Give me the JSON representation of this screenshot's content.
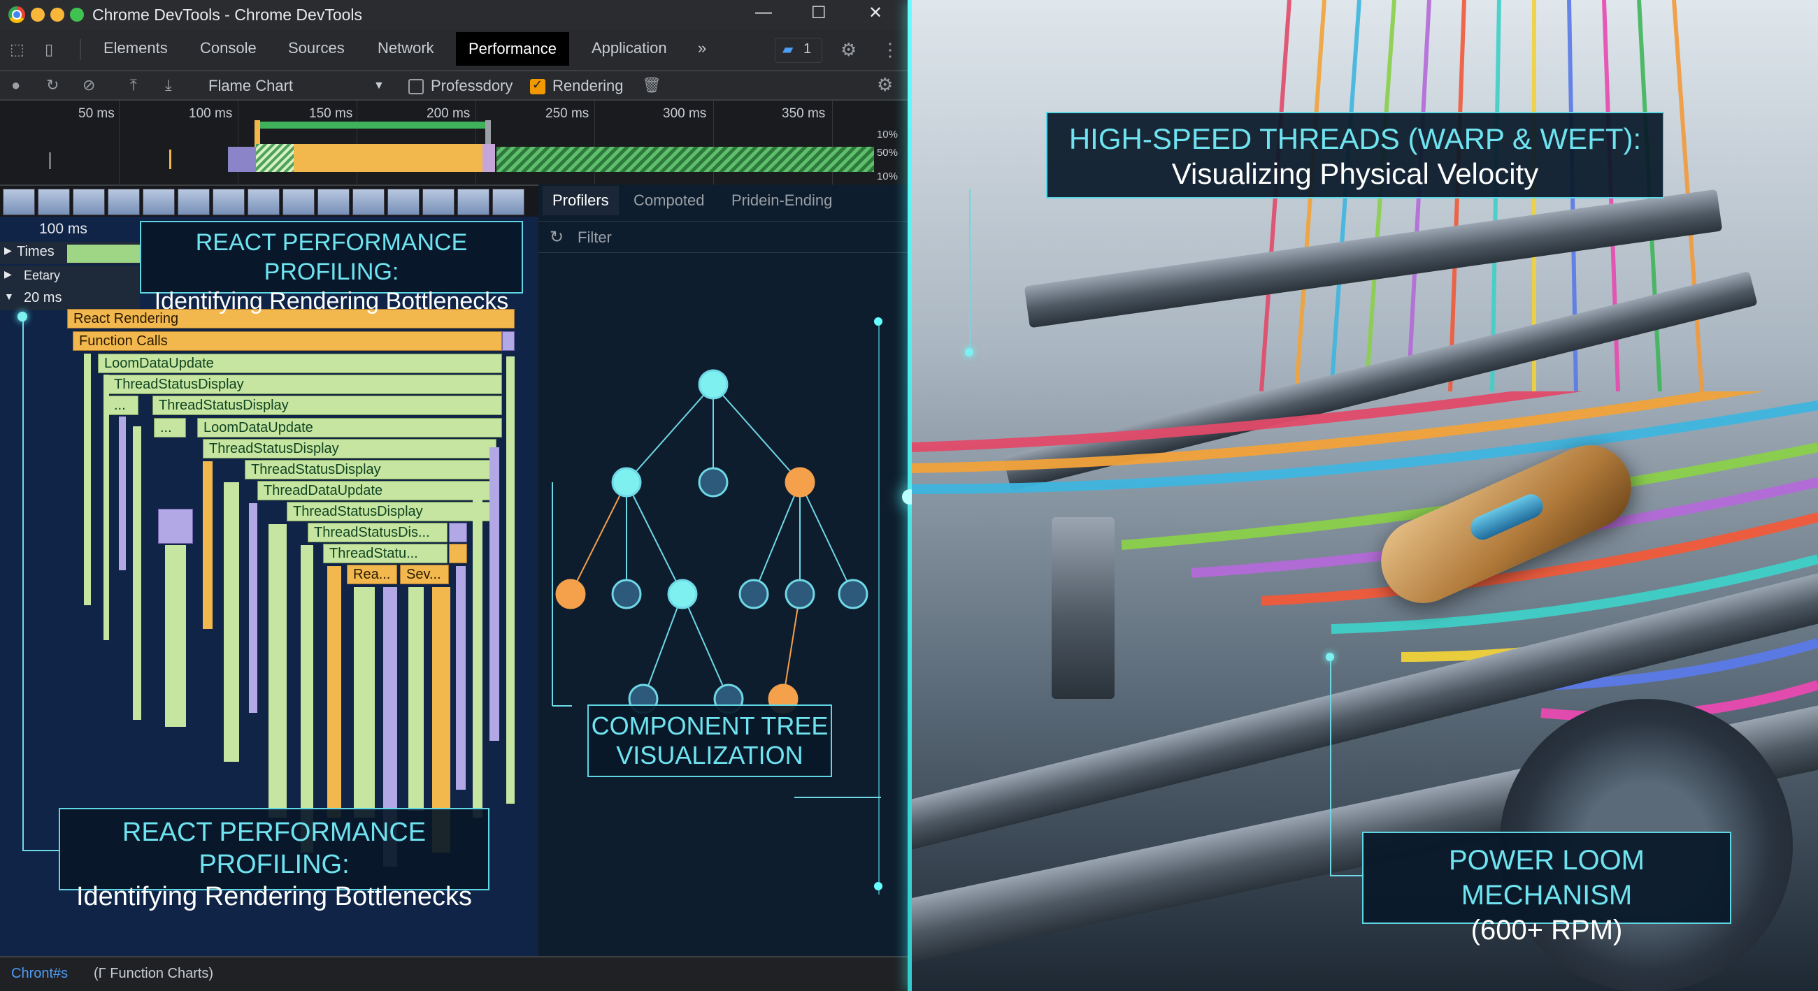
{
  "window": {
    "title": "Chrome DevTools - Chrome DevTools"
  },
  "tabs": [
    {
      "label": "Elements"
    },
    {
      "label": "Console"
    },
    {
      "label": "Sources"
    },
    {
      "label": "Network"
    },
    {
      "label": "Performance",
      "active": true
    },
    {
      "label": "Application"
    }
  ],
  "more_tabs": "»",
  "issues_count": "1",
  "toolbar": {
    "view_select": "Flame Chart",
    "checkbox1_label": "Professdory",
    "checkbox1_checked": false,
    "checkbox2_label": "Rendering",
    "checkbox2_checked": true
  },
  "overview": {
    "ruler": [
      "50 ms",
      "100 ms",
      "150 ms",
      "200 ms",
      "250 ms",
      "300 ms",
      "350 ms"
    ],
    "percents": [
      "10%",
      "50%",
      "10%"
    ]
  },
  "flame": {
    "time_label": "100 ms",
    "rows": [
      {
        "label": "Times"
      },
      {
        "label": "Eetary"
      },
      {
        "label": "20 ms"
      }
    ],
    "bars": [
      {
        "label": "React Rendering",
        "color": "orange"
      },
      {
        "label": "Function Calls",
        "color": "orange"
      },
      {
        "label": "LoomDataUpdate",
        "color": "green"
      },
      {
        "label": "ThreadStatusDisplay",
        "color": "green"
      },
      {
        "label": "...",
        "color": "green"
      },
      {
        "label": "ThreadStatusDisplay",
        "color": "green"
      },
      {
        "label": "...",
        "color": "green"
      },
      {
        "label": "LoomDataUpdate",
        "color": "green"
      },
      {
        "label": "ThreadStatusDisplay",
        "color": "green"
      },
      {
        "label": "ThreadStatusDisplay",
        "color": "green"
      },
      {
        "label": "ThreadDataUpdate",
        "color": "green"
      },
      {
        "label": "ThreadStatusDisplay",
        "color": "green"
      },
      {
        "label": "ThreadStatusDis...",
        "color": "green"
      },
      {
        "label": "ThreadStatu...",
        "color": "green"
      },
      {
        "label": "Rea...",
        "color": "orange"
      },
      {
        "label": "Sev...",
        "color": "orange"
      }
    ]
  },
  "profiler": {
    "tabs": [
      "Profilers",
      "Compoted",
      "Pridein-Ending"
    ],
    "filter_placeholder": "Filter"
  },
  "statusbar": {
    "left": "Chront#s",
    "right": "(Γ Function Charts)"
  },
  "callouts": {
    "react_top": {
      "line1": "REACT PERFORMANCE PROFILING:",
      "line2": "Identifying Rendering Bottlenecks"
    },
    "react_bottom": {
      "line1": "REACT PERFORMANCE PROFILING:",
      "line2": "Identifying Rendering Bottlenecks"
    },
    "component_tree": {
      "line1": "COMPONENT TREE",
      "line2": "VISUALIZATION"
    },
    "threads": {
      "line1": "HIGH-SPEED THREADS (WARP & WEFT):",
      "line2": "Visualizing Physical Velocity"
    },
    "loom": {
      "line1": "POWER LOOM MECHANISM",
      "line2": "(600+ RPM)"
    }
  },
  "colors": {
    "accent_cyan": "#5fd6e6",
    "flame_green": "#c5e5a0",
    "flame_orange": "#f2b84e",
    "flame_purple": "#b3a8e6",
    "node_orange": "#f5a04a"
  },
  "icons": [
    "chrome-logo-icon",
    "minimize-icon",
    "maximize-icon",
    "close-icon",
    "inspect-icon",
    "device-icon",
    "issues-icon",
    "settings-icon",
    "more-icon",
    "record-icon",
    "reload-icon",
    "clear-icon",
    "upload-icon",
    "download-icon",
    "trash-icon",
    "refresh-icon"
  ]
}
